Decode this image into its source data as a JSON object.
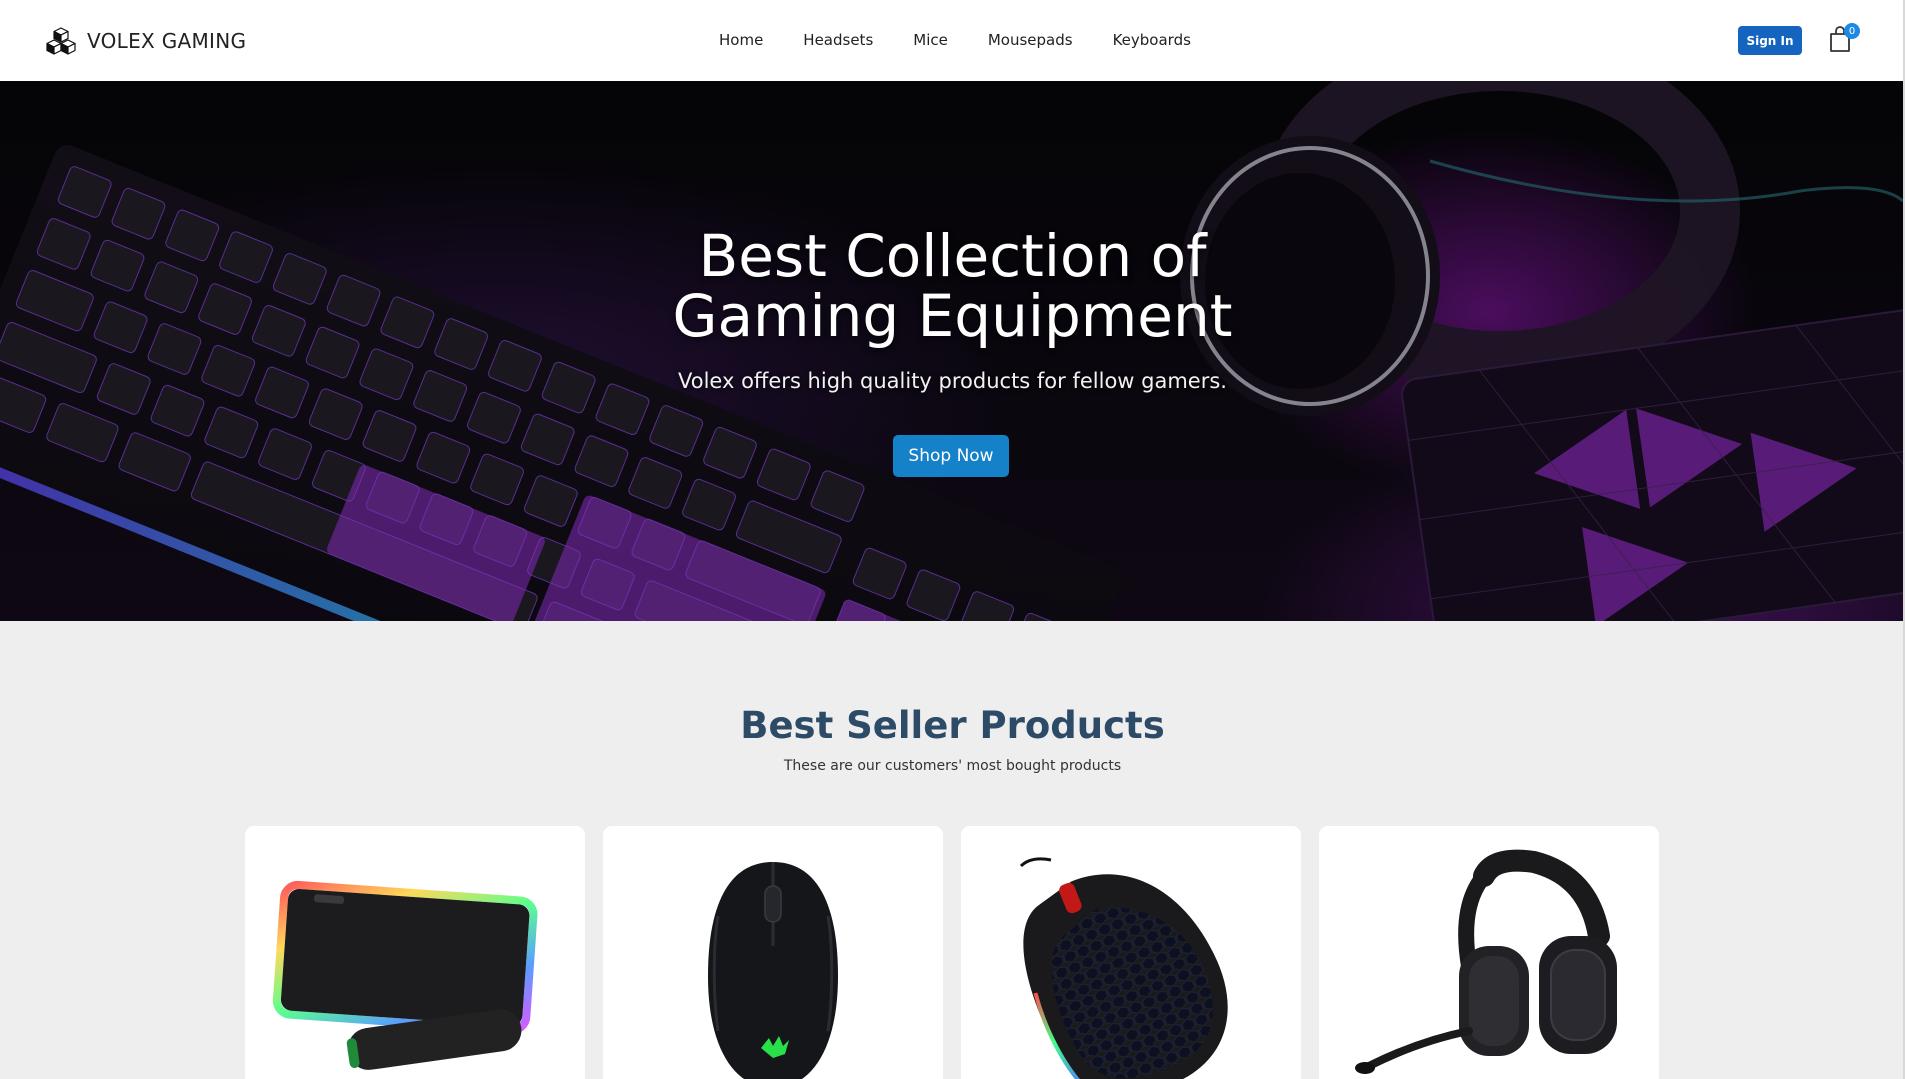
{
  "navbar": {
    "brand": "VOLEX GAMING",
    "brand_icon": "cubes-icon",
    "links": [
      "Home",
      "Headsets",
      "Mice",
      "Mousepads",
      "Keyboards"
    ],
    "signin_label": "Sign In",
    "cart_icon": "shopping-bag-icon",
    "cart_count": "0"
  },
  "hero": {
    "title_line1": "Best Collection of",
    "title_line2": "Gaming Equipment",
    "subtitle": "Volex offers high quality products for fellow gamers.",
    "cta_label": "Shop Now"
  },
  "best_sellers": {
    "title": "Best Seller Products",
    "subtitle": "These are our customers' most bought products",
    "products": [
      {
        "image": "rgb-mousepad-image"
      },
      {
        "image": "gaming-mouse-image"
      },
      {
        "image": "honeycomb-mouse-image"
      },
      {
        "image": "gaming-headset-image"
      }
    ]
  },
  "colors": {
    "accent": "#1565c0",
    "shop_button": "#1581c9",
    "section_title": "#2d4a67",
    "page_bg": "#eeeeee"
  }
}
